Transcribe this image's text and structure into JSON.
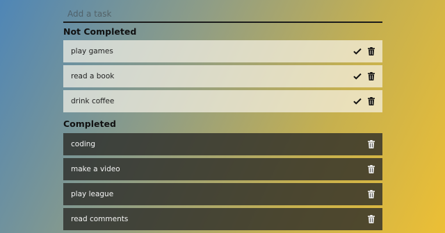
{
  "add_task": {
    "placeholder": "Add a task"
  },
  "not_completed": {
    "title": "Not Completed",
    "tasks": [
      {
        "label": "play games"
      },
      {
        "label": "read a book"
      },
      {
        "label": "drink coffee"
      }
    ]
  },
  "completed": {
    "title": "Completed",
    "tasks": [
      {
        "label": "coding"
      },
      {
        "label": "make a video"
      },
      {
        "label": "play league"
      },
      {
        "label": "read comments"
      }
    ]
  },
  "icons": {
    "complete": "check-icon",
    "delete": "trash-icon"
  },
  "colors": {
    "open_task_bg": "#e9e3d0",
    "done_task_bg": "#3a3a34",
    "input_underline": "#1b1b1b"
  }
}
